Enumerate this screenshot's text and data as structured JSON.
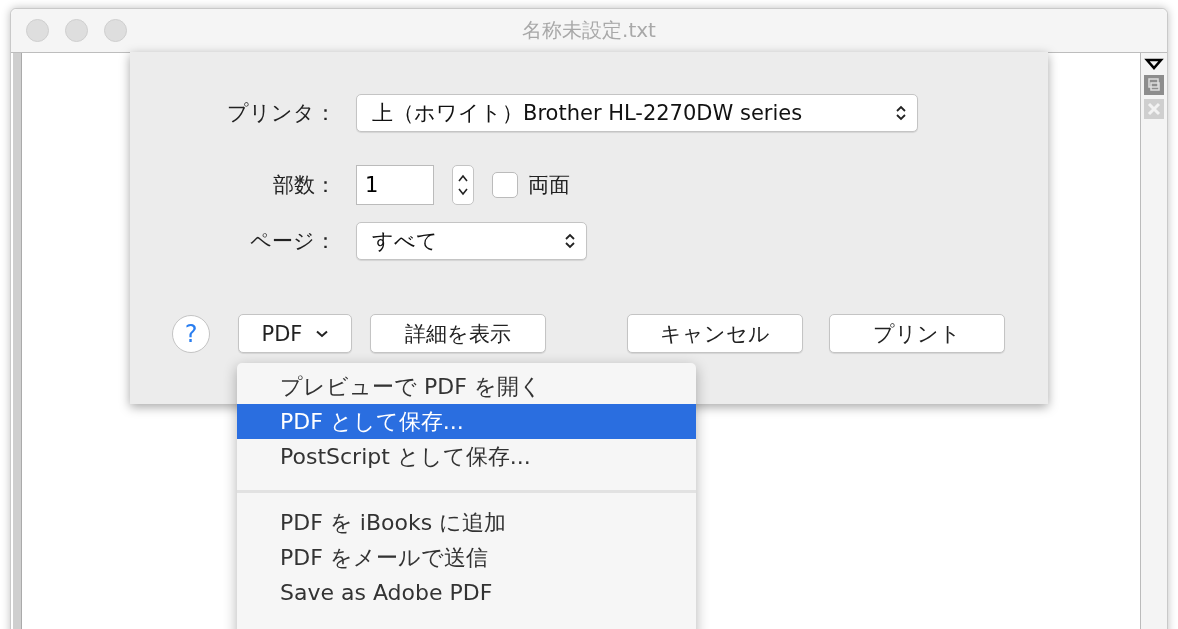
{
  "window": {
    "title": "名称未設定.txt"
  },
  "print_dialog": {
    "printer": {
      "label": "プリンタ：",
      "value": "上（ホワイト）Brother HL-2270DW series"
    },
    "copies": {
      "label": "部数：",
      "value": "1"
    },
    "duplex": {
      "label": "両面",
      "checked": false
    },
    "pages": {
      "label": "ページ：",
      "value": "すべて"
    },
    "help": "?",
    "pdf_button": "PDF",
    "details_button": "詳細を表示",
    "buttons": [
      "キャンセル",
      "プリント"
    ]
  },
  "pdf_menu": {
    "items": [
      {
        "kind": "item",
        "label": "プレビューで PDF を開く",
        "selected": false
      },
      {
        "kind": "item",
        "label": "PDF として保存...",
        "selected": true
      },
      {
        "kind": "item",
        "label": "PostScript として保存...",
        "selected": false
      },
      {
        "kind": "separator"
      },
      {
        "kind": "item",
        "label": "PDF を iBooks に追加",
        "selected": false
      },
      {
        "kind": "item",
        "label": "PDF をメールで送信",
        "selected": false
      },
      {
        "kind": "item",
        "label": "Save as Adobe PDF",
        "selected": false
      }
    ]
  }
}
